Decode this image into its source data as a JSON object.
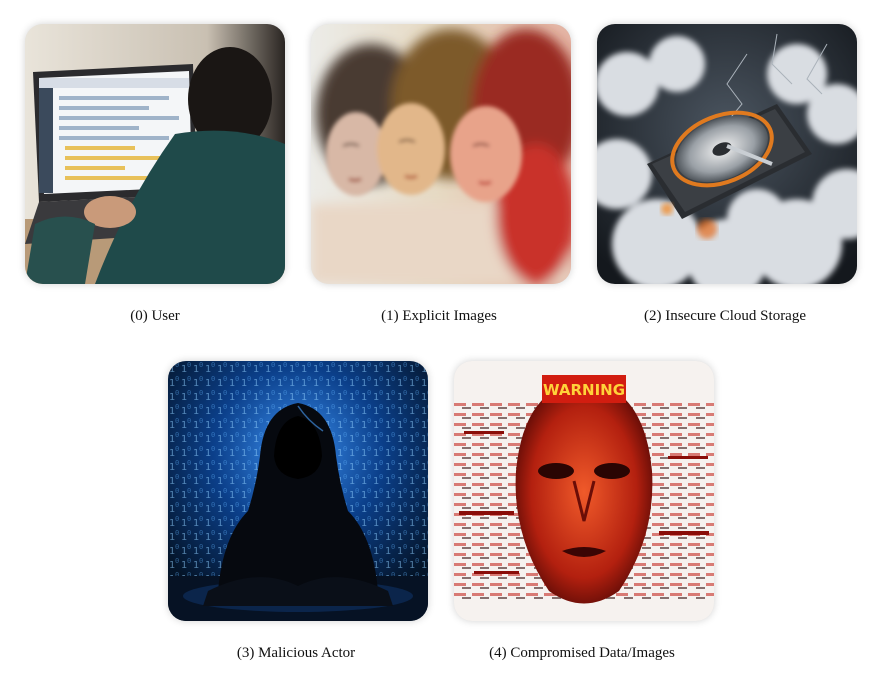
{
  "panels": [
    {
      "caption": "(0) User",
      "icon": "user-at-laptop-image"
    },
    {
      "caption": "(1) Explicit Images",
      "icon": "blurred-faces-image"
    },
    {
      "caption": "(2) Insecure Cloud Storage",
      "icon": "hard-drive-in-clouds-image"
    },
    {
      "caption": "(3) Malicious Actor",
      "icon": "hooded-hacker-image"
    },
    {
      "caption": "(4) Compromised Data/Images",
      "icon": "glitched-face-warning-image",
      "sign_text": "WARNING"
    }
  ]
}
